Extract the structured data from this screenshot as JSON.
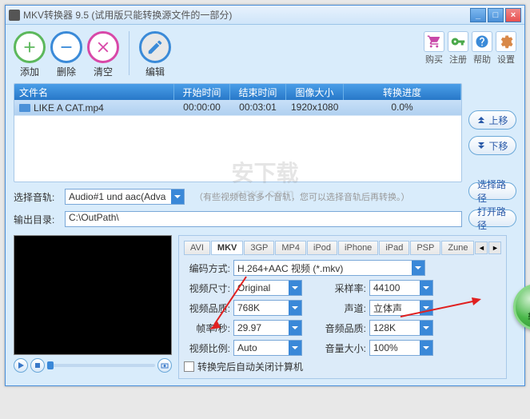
{
  "window": {
    "title": "MKV转换器 9.5 (试用版只能转换源文件的一部分)"
  },
  "toolbar": {
    "add": "添加",
    "del": "删除",
    "clear": "清空",
    "edit": "编辑",
    "buy": "购买",
    "register": "注册",
    "help": "帮助",
    "settings": "设置"
  },
  "table": {
    "headers": {
      "filename": "文件名",
      "start": "开始时间",
      "end": "结束时间",
      "size": "图像大小",
      "progress": "转换进度"
    },
    "row": {
      "filename": "LIKE A CAT.mp4",
      "start": "00:00:00",
      "end": "00:03:01",
      "size": "1920x1080",
      "progress": "0.0%"
    }
  },
  "side": {
    "up": "上移",
    "down": "下移"
  },
  "audio": {
    "label": "选择音轨:",
    "value": "Audio#1 und aac(Adva",
    "hint": "（有些视频包含多个音轨，您可以选择音轨后再转换。）"
  },
  "output": {
    "label": "输出目录:",
    "value": "C:\\OutPath\\",
    "select": "选择路径",
    "open": "打开路径"
  },
  "tabs": [
    "AVI",
    "MKV",
    "3GP",
    "MP4",
    "iPod",
    "iPhone",
    "iPad",
    "PSP",
    "Zune"
  ],
  "form": {
    "encoding_label": "编码方式:",
    "encoding": "H.264+AAC 视频 (*.mkv)",
    "vsize_label": "视频尺寸:",
    "vsize": "Original",
    "srate_label": "采样率:",
    "srate": "44100",
    "vbit_label": "视频品质:",
    "vbit": "768K",
    "channel_label": "声道:",
    "channel": "立体声",
    "fps_label": "帧率/秒:",
    "fps": "29.97",
    "abit_label": "音频品质:",
    "abit": "128K",
    "vratio_label": "视频比例:",
    "vratio": "Auto",
    "vol_label": "音量大小:",
    "vol": "100%",
    "shutdown": "转换完后自动关闭计算机"
  },
  "convert": "转换",
  "watermark": {
    "main": "安下载",
    "sub": "anxz.com"
  }
}
